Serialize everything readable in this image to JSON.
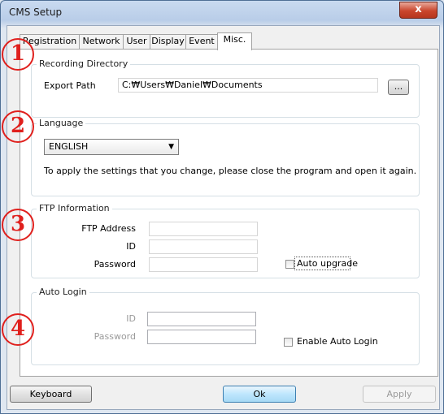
{
  "window": {
    "title": "CMS Setup",
    "close_glyph": "x"
  },
  "tabs": [
    {
      "label": "Registration"
    },
    {
      "label": "Network"
    },
    {
      "label": "User"
    },
    {
      "label": "Display"
    },
    {
      "label": "Event"
    },
    {
      "label": "Misc."
    }
  ],
  "active_tab": "Misc.",
  "recording": {
    "title": "Recording Directory",
    "export_label": "Export Path",
    "export_value": "C:₩Users₩Daniel₩Documents",
    "browse_label": "..."
  },
  "language": {
    "title": "Language",
    "selected": "ENGLISH",
    "note": "To apply the settings that you change, please close the program and open it again."
  },
  "ftp": {
    "title": "FTP Information",
    "address_label": "FTP Address",
    "id_label": "ID",
    "password_label": "Password",
    "address_value": "",
    "id_value": "",
    "password_value": "",
    "auto_upgrade_label": "Auto upgrade",
    "auto_upgrade_checked": false
  },
  "auto_login": {
    "title": "Auto Login",
    "id_label": "ID",
    "password_label": "Password",
    "id_value": "",
    "password_value": "",
    "enable_label": "Enable Auto Login",
    "enable_checked": false
  },
  "buttons": {
    "keyboard": "Keyboard",
    "ok": "Ok",
    "apply": "Apply"
  },
  "markers": [
    "1",
    "2",
    "3",
    "4"
  ],
  "marker_color": "#e0201d"
}
